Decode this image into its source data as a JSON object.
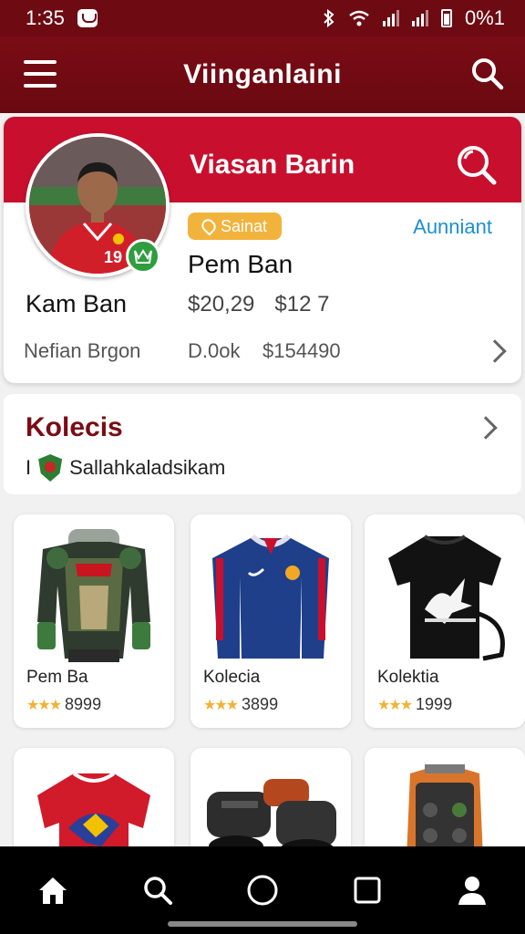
{
  "status_bar": {
    "time": "1:35",
    "battery": "0%1"
  },
  "app_bar": {
    "title": "Viinganlaini"
  },
  "profile": {
    "banner_title": "Viasan Barin",
    "badge_label": "Sainat",
    "link_right": "Aunniant",
    "name_right": "Pem Ban",
    "price_1": "$20,29",
    "price_2": "$12 7",
    "name_left": "Kam Ban",
    "stat_1": "Nefian Brgon",
    "stat_2": "D.0ok",
    "stat_3": "$154490"
  },
  "collection": {
    "title": "Kolecis",
    "subtitle_prefix": "I",
    "subtitle": "Sallahkaladsikam"
  },
  "products": [
    {
      "name": "Pem Ba",
      "rating": "8999"
    },
    {
      "name": "Kolecia",
      "rating": "3899"
    },
    {
      "name": "Kolektia",
      "rating": "1999"
    }
  ],
  "colors": {
    "primary_dark": "#6e0a12",
    "primary": "#c8102e",
    "accent_gold": "#f2b33d",
    "link_blue": "#1b8fd1"
  },
  "icons": {
    "menu": "hamburger-icon",
    "search": "search-icon",
    "home": "home-icon",
    "nav_search": "search-icon",
    "circle": "circle-icon",
    "square": "square-icon",
    "profile": "person-icon"
  }
}
